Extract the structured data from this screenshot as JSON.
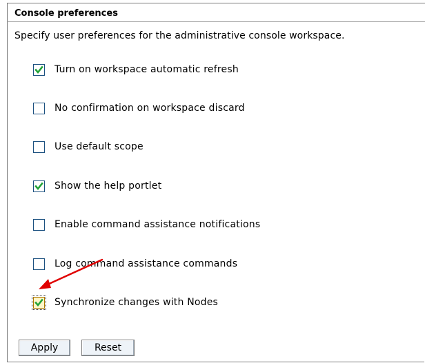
{
  "panel": {
    "title": "Console preferences",
    "description": "Specify user preferences for the administrative console workspace."
  },
  "preferences": [
    {
      "label": "Turn on workspace automatic refresh",
      "checked": true
    },
    {
      "label": "No confirmation on workspace discard",
      "checked": false
    },
    {
      "label": "Use default scope",
      "checked": false
    },
    {
      "label": "Show the help portlet",
      "checked": true
    },
    {
      "label": "Enable command assistance notifications",
      "checked": false
    },
    {
      "label": "Log command assistance commands",
      "checked": false
    },
    {
      "label": "Synchronize changes with Nodes",
      "checked": true,
      "focused": true
    }
  ],
  "buttons": {
    "apply_label": "Apply",
    "reset_label": "Reset"
  },
  "colors": {
    "checkmark": "#22a338",
    "checkbox_border": "#1c5180",
    "annotation_arrow": "#e00000"
  },
  "icons": {
    "checkmark": "checkmark-icon",
    "annotation": "red-arrow-icon"
  }
}
